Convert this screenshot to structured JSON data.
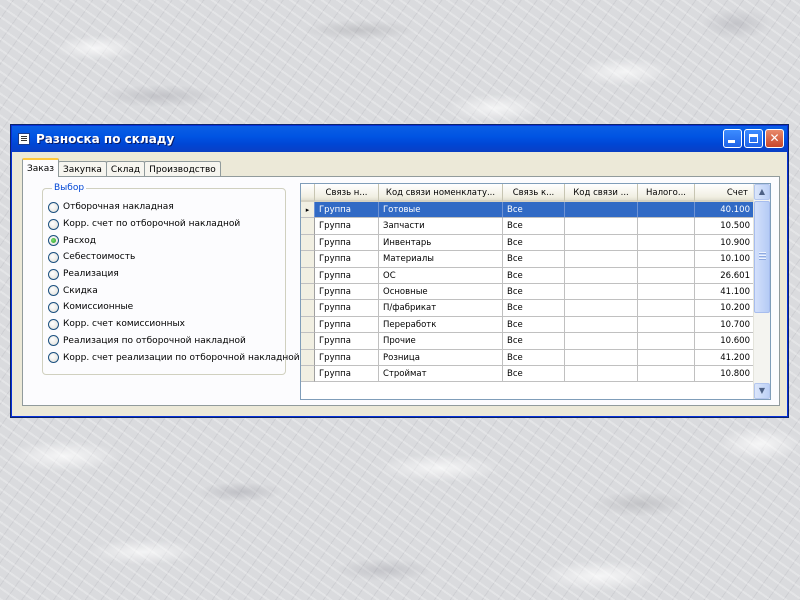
{
  "window": {
    "title": "Разноска по складу"
  },
  "tabs": [
    {
      "label": "Заказ",
      "active": true
    },
    {
      "label": "Закупка",
      "active": false
    },
    {
      "label": "Склад",
      "active": false
    },
    {
      "label": "Производство",
      "active": false
    }
  ],
  "choice_group": {
    "legend": "Выбор",
    "options": [
      {
        "label": "Отборочная накладная",
        "checked": false
      },
      {
        "label": "Корр. счет по отборочной накладной",
        "checked": false
      },
      {
        "label": "Расход",
        "checked": true
      },
      {
        "label": "Себестоимость",
        "checked": false
      },
      {
        "label": "Реализация",
        "checked": false
      },
      {
        "label": "Скидка",
        "checked": false
      },
      {
        "label": "Комиссионные",
        "checked": false
      },
      {
        "label": "Корр. счет комиссионных",
        "checked": false
      },
      {
        "label": "Реализация по отборочной накладной",
        "checked": false
      },
      {
        "label": "Корр. счет реализации по отборочной накладной",
        "checked": false
      }
    ]
  },
  "grid": {
    "columns": [
      "Связь н...",
      "Код связи номенклату...",
      "Связь к...",
      "Код связи ...",
      "Налого...",
      "Счет"
    ],
    "rows": [
      [
        "Группа",
        "Готовые",
        "Все",
        "",
        "",
        "40.100"
      ],
      [
        "Группа",
        "Запчасти",
        "Все",
        "",
        "",
        "10.500"
      ],
      [
        "Группа",
        "Инвентарь",
        "Все",
        "",
        "",
        "10.900"
      ],
      [
        "Группа",
        "Материалы",
        "Все",
        "",
        "",
        "10.100"
      ],
      [
        "Группа",
        "ОС",
        "Все",
        "",
        "",
        "26.601"
      ],
      [
        "Группа",
        "Основные",
        "Все",
        "",
        "",
        "41.100"
      ],
      [
        "Группа",
        "П/фабрикат",
        "Все",
        "",
        "",
        "10.200"
      ],
      [
        "Группа",
        "Переработк",
        "Все",
        "",
        "",
        "10.700"
      ],
      [
        "Группа",
        "Прочие",
        "Все",
        "",
        "",
        "10.600"
      ],
      [
        "Группа",
        "Розница",
        "Все",
        "",
        "",
        "41.200"
      ],
      [
        "Группа",
        "Строймат",
        "Все",
        "",
        "",
        "10.800"
      ]
    ],
    "selected_row": 0,
    "current_row_marker": "▸"
  },
  "colors": {
    "titlebar": "#0054e3",
    "selection": "#316ac5",
    "tab_highlight": "#ffc83c",
    "group_legend": "#0046d5"
  },
  "icons": {
    "app": "app-icon",
    "minimize": "minimize-icon",
    "maximize": "maximize-icon",
    "close": "close-icon",
    "scroll_up": "chevron-up-icon",
    "scroll_down": "chevron-down-icon"
  }
}
